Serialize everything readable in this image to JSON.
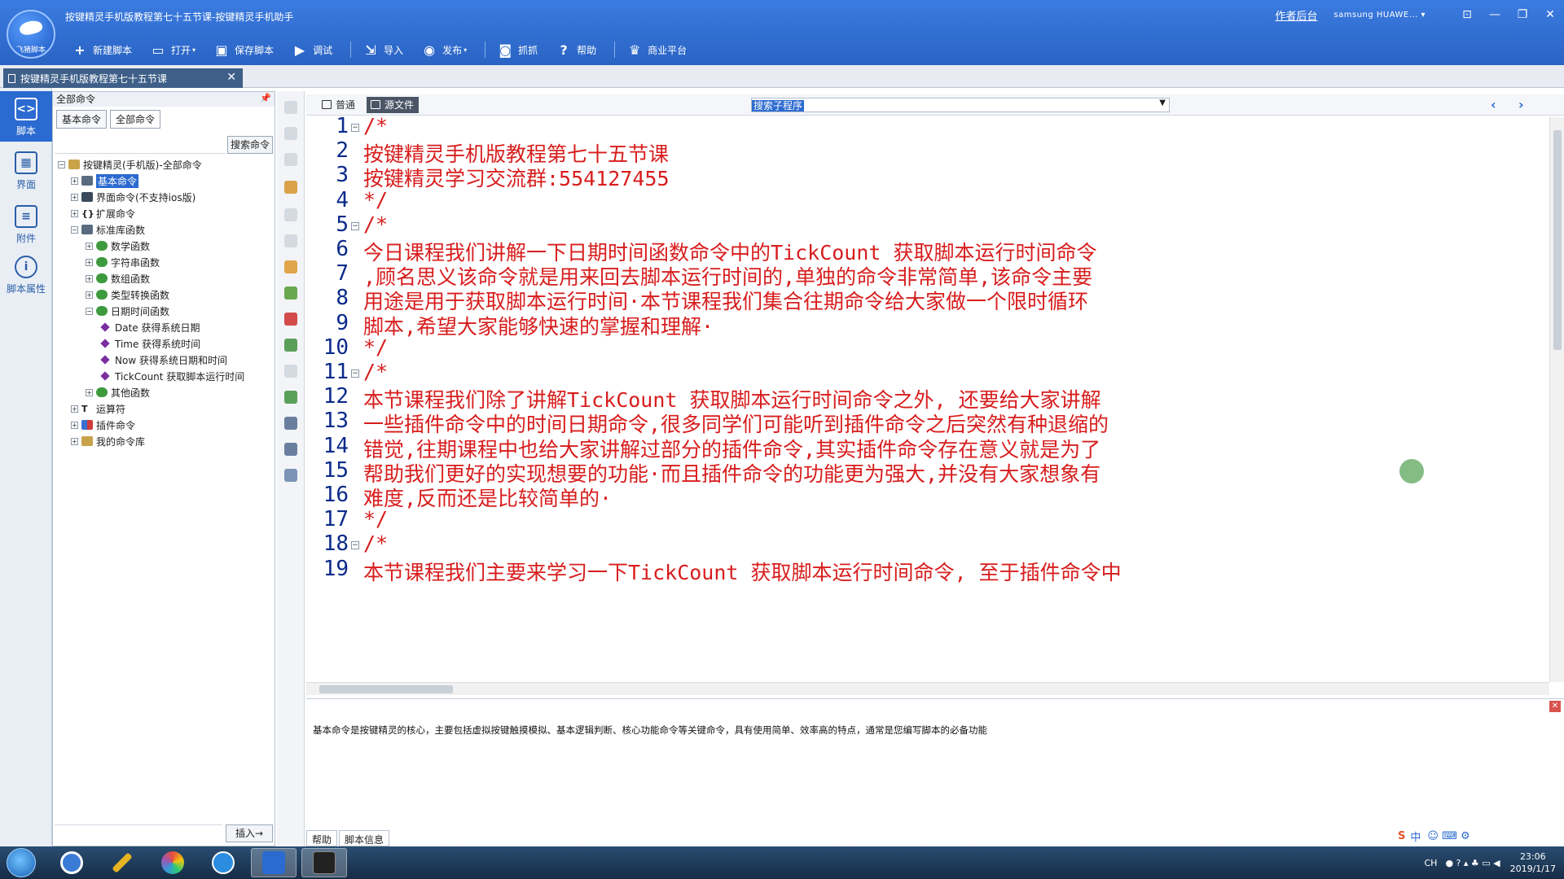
{
  "window": {
    "title": "按键精灵手机版教程第七十五节课-按键精灵手机助手",
    "logo_text": "飞猪脚本",
    "top_right_link": "作者后台",
    "device": "samsung  HUAWE..."
  },
  "toolbar": {
    "items": [
      "新建脚本",
      "打开",
      "保存脚本",
      "调试",
      "导入",
      "发布",
      "抓抓",
      "帮助",
      "商业平台"
    ]
  },
  "doc_tab": {
    "label": "按键精灵手机版教程第七十五节课"
  },
  "rail": {
    "items": [
      "脚本",
      "界面",
      "附件",
      "脚本属性"
    ]
  },
  "command_panel": {
    "title": "全部命令",
    "tabs": [
      "基本命令",
      "全部命令"
    ],
    "search_button": "搜索命令",
    "insert_button": "插入→",
    "tree": [
      "按键精灵(手机版)-全部命令",
      "基本命令",
      "界面命令(不支持ios版)",
      "扩展命令",
      "标准库函数",
      "数学函数",
      "字符串函数",
      "数组函数",
      "类型转换函数",
      "日期时间函数",
      "Date 获得系统日期",
      "Time 获得系统时间",
      "Now 获得系统日期和时间",
      "TickCount 获取脚本运行时间",
      "其他函数",
      "运算符",
      "插件命令",
      "我的命令库"
    ]
  },
  "editor": {
    "view_tabs": [
      "普通",
      "源文件"
    ],
    "subroutine_search": "搜索子程序",
    "lines": [
      "/*",
      "按键精灵手机版教程第七十五节课",
      "按键精灵学习交流群:554127455",
      "*/",
      "/*",
      "今日课程我们讲解一下日期时间函数命令中的TickCount 获取脚本运行时间命令",
      ",顾名思义该命令就是用来回去脚本运行时间的,单独的命令非常简单,该命令主要",
      "用途是用于获取脚本运行时间·本节课程我们集合往期命令给大家做一个限时循环",
      "脚本,希望大家能够快速的掌握和理解·",
      "*/",
      "/*",
      "本节课程我们除了讲解TickCount 获取脚本运行时间命令之外, 还要给大家讲解",
      "一些插件命令中的时间日期命令,很多同学们可能听到插件命令之后突然有种退缩的",
      "错觉,往期课程中也给大家讲解过部分的插件命令,其实插件命令存在意义就是为了",
      "帮助我们更好的实现想要的功能·而且插件命令的功能更为强大,并没有大家想象有",
      "难度,反而还是比较简单的·",
      "*/",
      "/*",
      "本节课程我们主要来学习一下TickCount 获取脚本运行时间命令, 至于插件命令中"
    ]
  },
  "help": {
    "text": "基本命令是按键精灵的核心，主要包括虚拟按键触摸模拟、基本逻辑判断、核心功能命令等关键命令，具有使用简单、效率高的特点，通常是您编写脚本的必备功能",
    "tabs": [
      "帮助",
      "脚本信息"
    ]
  },
  "taskbar": {
    "time": "23:06",
    "date": "2019/1/17",
    "lang": "CH",
    "ime": "中"
  },
  "colors": {
    "accent": "#2b6ad0",
    "code_red": "#d81d1d",
    "line_number": "#0a2a8a"
  }
}
